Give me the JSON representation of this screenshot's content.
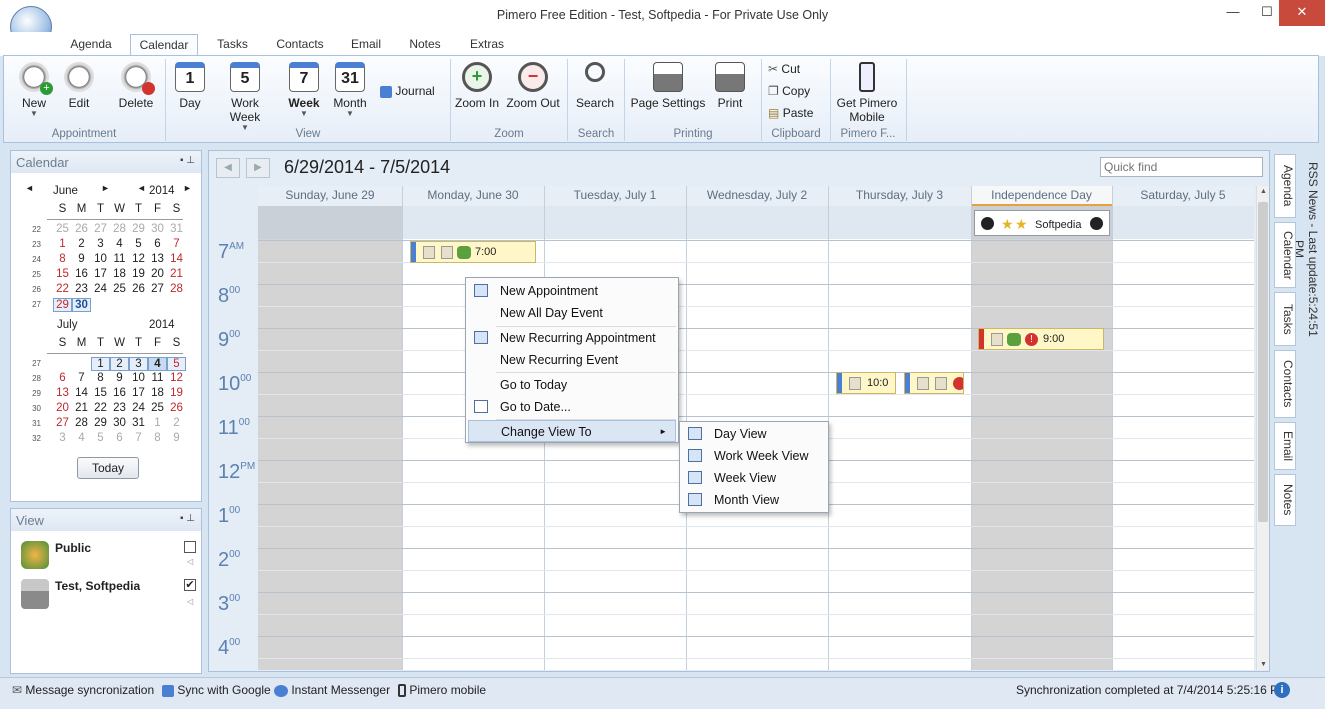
{
  "window": {
    "title": "Pimero Free Edition - Test, Softpedia - For Private Use Only",
    "min": "—",
    "max": "☐",
    "close": "✕"
  },
  "tabs": [
    "Agenda",
    "Calendar",
    "Tasks",
    "Contacts",
    "Email",
    "Notes",
    "Extras"
  ],
  "ribbon": {
    "appointment": {
      "new": "New",
      "edit": "Edit",
      "delete": "Delete",
      "group": "Appointment"
    },
    "view": {
      "day": "Day",
      "day_num": "1",
      "workweek": "Work Week",
      "workweek_num": "5",
      "week": "Week",
      "week_num": "7",
      "month": "Month",
      "month_num": "31",
      "journal": "Journal",
      "group": "View"
    },
    "zoom": {
      "in": "Zoom In",
      "out": "Zoom Out",
      "group": "Zoom"
    },
    "search": {
      "label": "Search",
      "group": "Search"
    },
    "printing": {
      "page_settings": "Page Settings",
      "print": "Print",
      "group": "Printing"
    },
    "clipboard": {
      "cut": "Cut",
      "copy": "Copy",
      "paste": "Paste",
      "group": "Clipboard"
    },
    "mobile": {
      "label1": "Get Pimero",
      "label2": "Mobile",
      "group": "Pimero F..."
    }
  },
  "calendar_panel": {
    "title": "Calendar",
    "june": {
      "month": "June",
      "year": "2014",
      "dow": [
        "S",
        "M",
        "T",
        "W",
        "T",
        "F",
        "S"
      ],
      "weeks": [
        [
          "22",
          "25",
          "26",
          "27",
          "28",
          "29",
          "30",
          "31"
        ],
        [
          "23",
          "1",
          "2",
          "3",
          "4",
          "5",
          "6",
          "7"
        ],
        [
          "24",
          "8",
          "9",
          "10",
          "11",
          "12",
          "13",
          "14"
        ],
        [
          "25",
          "15",
          "16",
          "17",
          "18",
          "19",
          "20",
          "21"
        ],
        [
          "26",
          "22",
          "23",
          "24",
          "25",
          "26",
          "27",
          "28"
        ],
        [
          "27",
          "29",
          "30",
          "",
          "",
          "",
          "",
          ""
        ]
      ]
    },
    "july": {
      "month": "July",
      "year": "2014",
      "dow": [
        "S",
        "M",
        "T",
        "W",
        "T",
        "F",
        "S"
      ],
      "weeks": [
        [
          "27",
          "",
          "",
          "1",
          "2",
          "3",
          "4",
          "5"
        ],
        [
          "28",
          "6",
          "7",
          "8",
          "9",
          "10",
          "11",
          "12"
        ],
        [
          "29",
          "13",
          "14",
          "15",
          "16",
          "17",
          "18",
          "19"
        ],
        [
          "30",
          "20",
          "21",
          "22",
          "23",
          "24",
          "25",
          "26"
        ],
        [
          "31",
          "27",
          "28",
          "29",
          "30",
          "31",
          "1",
          "2"
        ],
        [
          "32",
          "3",
          "4",
          "5",
          "6",
          "7",
          "8",
          "9"
        ]
      ]
    },
    "today": "Today"
  },
  "view_panel": {
    "title": "View",
    "items": [
      {
        "name": "Public",
        "checked": false
      },
      {
        "name": "Test, Softpedia",
        "checked": true
      }
    ]
  },
  "main": {
    "date_range": "6/29/2014 - 7/5/2014",
    "quick_find_placeholder": "Quick find",
    "days": [
      "Sunday, June 29",
      "Monday, June 30",
      "Tuesday, July 1",
      "Wednesday, July 2",
      "Thursday, July 3",
      "Independence Day",
      "Saturday, July 5"
    ],
    "hours": [
      {
        "h": "7",
        "s": "AM"
      },
      {
        "h": "8",
        "s": "00"
      },
      {
        "h": "9",
        "s": "00"
      },
      {
        "h": "10",
        "s": "00"
      },
      {
        "h": "11",
        "s": "00"
      },
      {
        "h": "12",
        "s": "PM"
      },
      {
        "h": "1",
        "s": "00"
      },
      {
        "h": "2",
        "s": "00"
      },
      {
        "h": "3",
        "s": "00"
      },
      {
        "h": "4",
        "s": "00"
      }
    ],
    "appointments": {
      "allday": "Softpedia",
      "mon": "7:00",
      "fri": "9:00",
      "thu": "10:0"
    }
  },
  "context_menu": {
    "items": [
      "New Appointment",
      "New All Day Event",
      "New Recurring Appointment",
      "New Recurring Event",
      "Go to Today",
      "Go to Date...",
      "Change View To"
    ]
  },
  "submenu": {
    "items": [
      "Day View",
      "Work Week View",
      "Week View",
      "Month View"
    ]
  },
  "right_tabs": [
    "RSS News - Last update:5:24:51 PM",
    "Agenda",
    "Calendar",
    "Tasks",
    "Contacts",
    "Email",
    "Notes"
  ],
  "statusbar": {
    "sync": "Message syncronization",
    "google": "Sync with Google",
    "im": "Instant Messenger",
    "mobile": "Pimero mobile",
    "status": "Synchronization completed at 7/4/2014 5:25:16 PM"
  }
}
